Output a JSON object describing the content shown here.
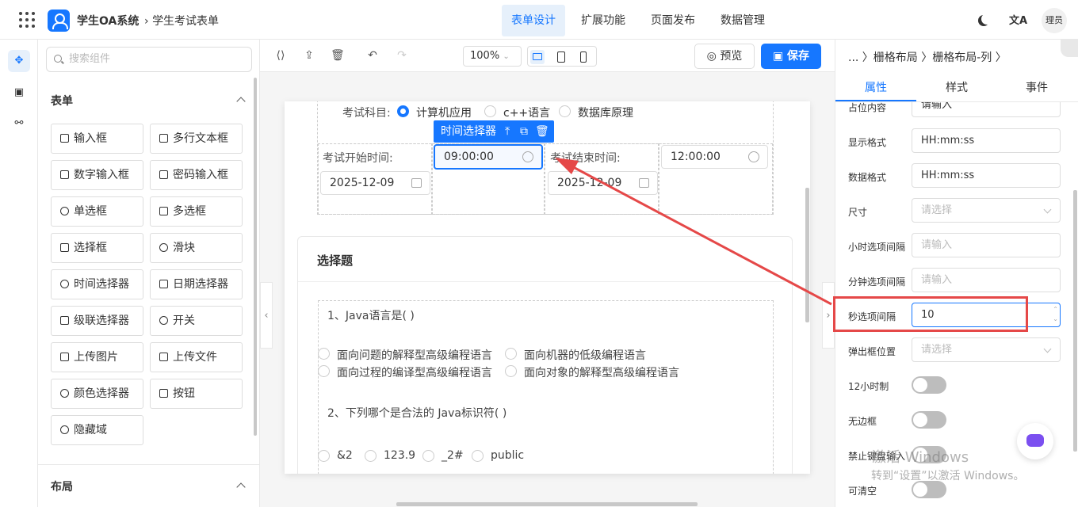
{
  "header": {
    "app_title": "学生OA系统",
    "breadcrumb": "学生考试表单",
    "nav_tabs": [
      "表单设计",
      "扩展功能",
      "页面发布",
      "数据管理"
    ],
    "translate_glyph": "文A",
    "user": "理员"
  },
  "sidebar": {
    "search_placeholder": "搜索组件",
    "group_form": "表单",
    "group_layout": "布局",
    "components": [
      "输入框",
      "多行文本框",
      "数字输入框",
      "密码输入框",
      "单选框",
      "多选框",
      "选择框",
      "滑块",
      "时间选择器",
      "日期选择器",
      "级联选择器",
      "开关",
      "上传图片",
      "上传文件",
      "颜色选择器",
      "按钮",
      "隐藏域"
    ]
  },
  "toolbar": {
    "zoom": "100%",
    "preview_label": "预览",
    "save_label": "保存"
  },
  "form": {
    "subject_label": "考试科目:",
    "subject_options": [
      "计算机应用",
      "c++语言",
      "数据库原理"
    ],
    "selected_subject": "计算机应用",
    "selected_tooltip": "时间选择器",
    "start_label": "考试开始时间:",
    "start_date": "2025-12-09",
    "start_time": "09:00:00",
    "end_label": "考试结束时间:",
    "end_date": "2025-12-09",
    "end_time": "12:00:00",
    "section_title": "选择题",
    "q1": "1、Java语言是( )",
    "q1_options": [
      "面向问题的解释型高级编程语言",
      "面向机器的低级编程语言",
      "面向过程的编译型高级编程语言",
      "面向对象的解释型高级编程语言"
    ],
    "q2": "2、下列哪个是合法的 Java标识符( )",
    "q2_options": [
      "&2",
      "123.9",
      "_2#",
      "public"
    ]
  },
  "properties": {
    "breadcrumb": "... 〉栅格布局 〉栅格布局-列 〉",
    "tabs": [
      "属性",
      "样式",
      "事件"
    ],
    "active_tab": "属性",
    "fields": [
      {
        "label": "占位内容",
        "value": "请输入"
      },
      {
        "label": "显示格式",
        "value": "HH:mm:ss"
      },
      {
        "label": "数据格式",
        "value": "HH:mm:ss"
      },
      {
        "label": "尺寸",
        "placeholder": "请选择"
      },
      {
        "label": "小时选项间隔",
        "placeholder": "请输入"
      },
      {
        "label": "分钟选项间隔",
        "placeholder": "请输入"
      },
      {
        "label": "秒选项间隔",
        "value": "10"
      },
      {
        "label": "弹出框位置",
        "placeholder": "请选择"
      }
    ],
    "toggles": [
      {
        "label": "12小时制",
        "on": false
      },
      {
        "label": "无边框",
        "on": false
      },
      {
        "label": "禁止键盘输入",
        "on": false
      },
      {
        "label": "可清空",
        "on": false
      }
    ]
  },
  "watermark": {
    "line1": "激活 Windows",
    "line2": "转到“设置”以激活 Windows。"
  },
  "colors": {
    "accent": "#1677ff",
    "highlight": "#e54848"
  }
}
